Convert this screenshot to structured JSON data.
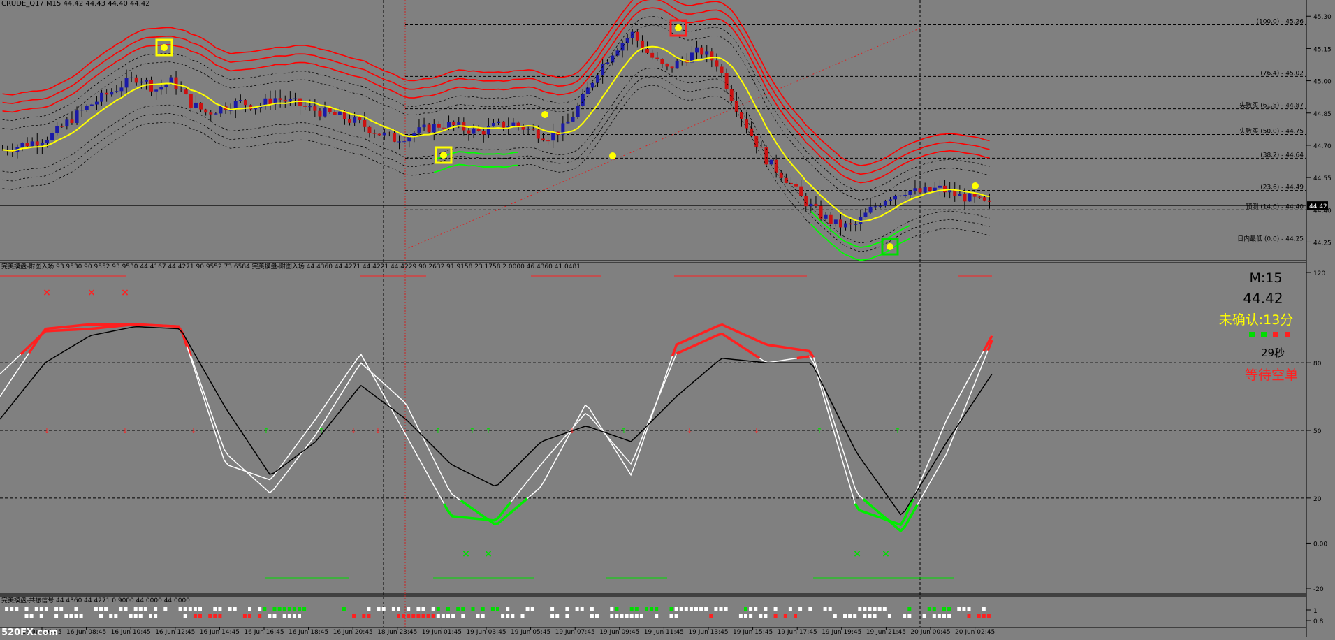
{
  "window": {
    "symbol_line": "CRUDE_Q17,M15  44.42 44.43 44.40 44.42",
    "indicator1_line": "完美摸盘-附图入场 93.9530 90.9552 93.9530 44.4167 44.4271 90.9552 73.6584  完美摸盘-附图入场 44.4360 44.4271 44.4221 44.4229 90.2632 91.9158 23.1758 2.0000 46.4360 41.0481",
    "indicator2_line": "完美摸盘-共振信号 44.4360 44.4271 0.9000 44.0000 44.0000",
    "watermark": "520FX.com"
  },
  "status_panel": {
    "timeframe": "M:15",
    "price": "44.42",
    "unconfirmed": "未确认:13分",
    "seconds": "29秒",
    "signal": "等待空单",
    "squares": [
      "#00dd00",
      "#00dd00",
      "#ff2020",
      "#ff2020"
    ]
  },
  "colors": {
    "background": "#808080",
    "bull_candle": "#1a1aa8",
    "bear_candle": "#cc1111",
    "ma_line": "#ffff00",
    "upper_band": "#ff0000",
    "lower_band": "#00ff00",
    "osc_white": "#ffffff",
    "osc_black": "#000000"
  },
  "chart_data": [
    {
      "type": "candlestick",
      "title": "CRUDE_Q17,M15",
      "ylim": [
        44.18,
        45.33
      ],
      "y_ticks": [
        45.3,
        45.15,
        45.0,
        44.85,
        44.7,
        44.55,
        44.4,
        44.25
      ],
      "current_price": 44.42,
      "fib_levels": [
        {
          "label": "(100.0) - 45.26",
          "value": 45.26
        },
        {
          "label": "(76.4) - 45.02",
          "value": 45.02
        },
        {
          "label": "失败买 (61.8) - 44.87",
          "value": 44.87
        },
        {
          "label": "失败买 (50.0) - 44.75",
          "value": 44.75
        },
        {
          "label": "(38.2) - 44.64",
          "value": 44.64
        },
        {
          "label": "(23.6) - 44.49",
          "value": 44.49
        },
        {
          "label": "预测 (14.6) - 44.40",
          "value": 44.4
        },
        {
          "label": "日内最低 (0.0) - 44.25",
          "value": 44.25
        }
      ],
      "x_labels": [
        "16 Jun 06:45",
        "16 Jun 08:45",
        "16 Jun 10:45",
        "16 Jun 12:45",
        "16 Jun 14:45",
        "16 Jun 16:45",
        "16 Jun 18:45",
        "16 Jun 20:45",
        "18 Jun 23:45",
        "19 Jun 01:45",
        "19 Jun 03:45",
        "19 Jun 05:45",
        "19 Jun 07:45",
        "19 Jun 09:45",
        "19 Jun 11:45",
        "19 Jun 13:45",
        "19 Jun 15:45",
        "19 Jun 17:45",
        "19 Jun 19:45",
        "19 Jun 21:45",
        "20 Jun 00:45",
        "20 Jun 02:45"
      ],
      "close_path": [
        44.68,
        44.7,
        44.72,
        44.75,
        44.82,
        44.88,
        44.93,
        44.98,
        45.02,
        44.96,
        45.0,
        44.9,
        44.85,
        44.88,
        44.9,
        44.88,
        44.92,
        44.9,
        44.87,
        44.85,
        44.83,
        44.8,
        44.76,
        44.73,
        44.75,
        44.78,
        44.8,
        44.78,
        44.76,
        44.79,
        44.8,
        44.77,
        44.74,
        44.78,
        44.9,
        45.05,
        45.15,
        45.22,
        45.12,
        45.05,
        45.1,
        45.14,
        45.08,
        44.9,
        44.75,
        44.62,
        44.55,
        44.45,
        44.38,
        44.33,
        44.32,
        44.4,
        44.46,
        44.49,
        44.48,
        44.5,
        44.47,
        44.45,
        44.42
      ]
    },
    {
      "type": "line",
      "title": "完美摸盘-附图入场",
      "ylim": [
        -20,
        120
      ],
      "y_ticks": [
        120,
        80,
        50,
        20,
        0.0,
        -20
      ],
      "series": [
        {
          "name": "",
          "values": [
            65,
            95,
            97,
            97,
            96,
            40,
            22,
            48,
            80,
            62,
            22,
            8,
            25,
            62,
            30,
            88,
            97,
            88,
            85,
            22,
            5,
            40,
            90
          ]
        },
        {
          "name": "",
          "values": [
            75,
            94,
            95,
            97,
            96,
            35,
            28,
            55,
            84,
            48,
            12,
            10,
            35,
            58,
            35,
            84,
            93,
            80,
            83,
            15,
            8,
            55,
            92
          ]
        },
        {
          "name": "",
          "values": [
            55,
            80,
            92,
            96,
            95,
            60,
            30,
            45,
            70,
            55,
            35,
            25,
            45,
            52,
            45,
            65,
            82,
            80,
            80,
            40,
            12,
            45,
            75
          ]
        }
      ]
    },
    {
      "type": "heatmap",
      "title": "完美摸盘-共振信号",
      "y_ticks": [
        1,
        0.8
      ]
    }
  ]
}
